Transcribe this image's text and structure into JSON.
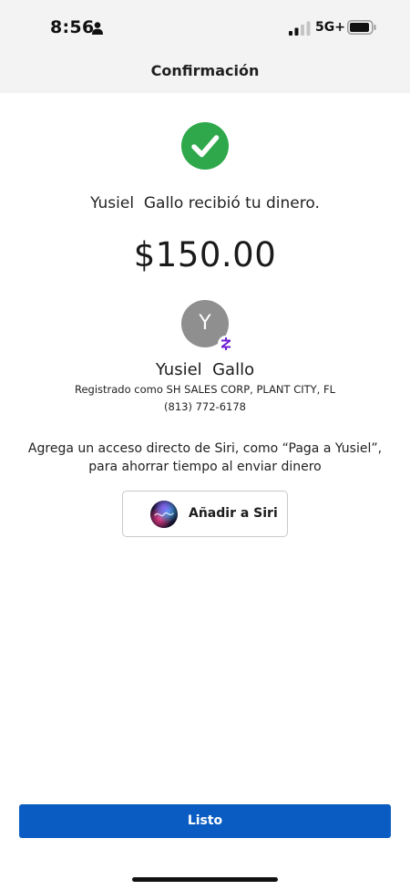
{
  "status_bar": {
    "time": "8:56",
    "network": "5G+"
  },
  "header": {
    "title": "Confirmación"
  },
  "confirmation": {
    "message": "Yusiel  Gallo recibió tu dinero.",
    "amount": "$150.00"
  },
  "recipient": {
    "initial": "Y",
    "name": "Yusiel  Gallo",
    "registered": "Registrado como SH SALES CORP, PLANT CITY, FL",
    "phone": "(813) 772-6178"
  },
  "siri": {
    "prompt": "Agrega un acceso directo de Siri, como “Paga a Yusiel”, para ahorrar tiempo al enviar dinero",
    "button_label": "Añadir a Siri"
  },
  "footer": {
    "done_label": "Listo"
  },
  "colors": {
    "success": "#2ea84a",
    "primary_button": "#0a5cc2",
    "zelle": "#6d1ed4",
    "avatar": "#8f8f8f"
  },
  "icons": [
    "person-icon",
    "signal-icon",
    "battery-icon",
    "checkmark-icon",
    "zelle-icon",
    "siri-icon"
  ]
}
